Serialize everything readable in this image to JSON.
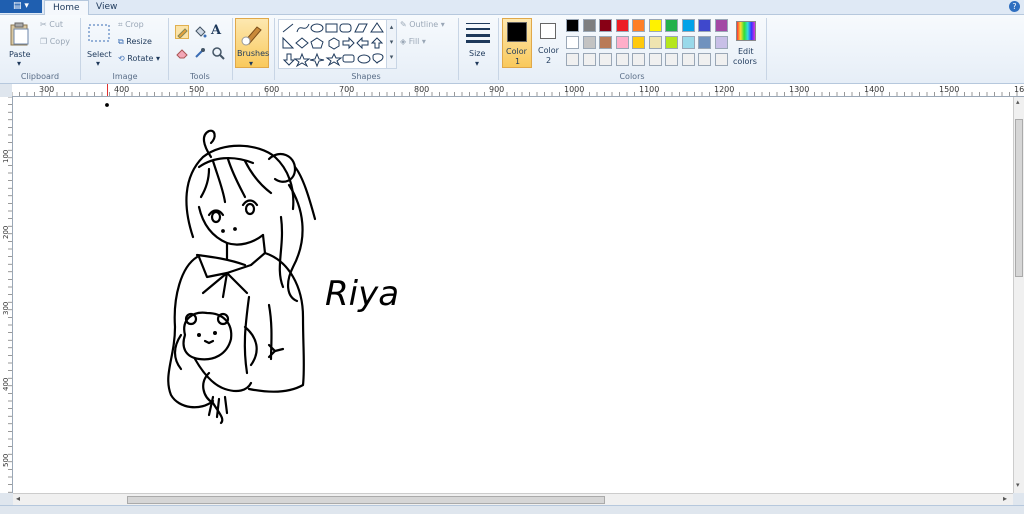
{
  "tabs": {
    "home": "Home",
    "view": "View"
  },
  "app_button": {
    "glyph": "▤ ▾"
  },
  "help": {
    "glyph": "?"
  },
  "clipboard": {
    "paste": "Paste",
    "cut": "Cut",
    "copy": "Copy",
    "label": "Clipboard"
  },
  "image": {
    "select": "Select",
    "crop": "Crop",
    "resize": "Resize",
    "rotate": "Rotate",
    "label": "Image"
  },
  "tools": {
    "label": "Tools"
  },
  "brushes": {
    "label": "Brushes"
  },
  "shapes": {
    "outline": "Outline",
    "fill": "Fill",
    "label": "Shapes"
  },
  "size": {
    "label": "Size"
  },
  "color_selectors": {
    "color1": "Color\n1",
    "color1_line1": "Color",
    "color1_line2": "1",
    "color2_line1": "Color",
    "color2_line2": "2",
    "color1_value": "#000000",
    "color2_value": "#ffffff"
  },
  "colors": {
    "label": "Colors",
    "row1": [
      "#000000",
      "#7f7f7f",
      "#880015",
      "#ed1c24",
      "#ff7f27",
      "#fff200",
      "#22b14c",
      "#00a2e8",
      "#3f48cc",
      "#a349a4"
    ],
    "row2": [
      "#ffffff",
      "#c3c3c3",
      "#b97a57",
      "#ffaec9",
      "#ffc90e",
      "#efe4b0",
      "#b5e61d",
      "#99d9ea",
      "#7092be",
      "#c8bfe7"
    ],
    "row3": [
      "#f0f0f0",
      "#f0f0f0",
      "#f0f0f0",
      "#f0f0f0",
      "#f0f0f0",
      "#f0f0f0",
      "#f0f0f0",
      "#f0f0f0",
      "#f0f0f0",
      "#f0f0f0"
    ]
  },
  "edit_colors": {
    "line1": "Edit",
    "line2": "colors"
  },
  "ruler": {
    "h_ticks": [
      "300",
      "400",
      "500",
      "600",
      "700",
      "800",
      "900",
      "1000",
      "1100",
      "1200",
      "1300",
      "1400",
      "1500",
      "16"
    ],
    "v_ticks": [
      "100",
      "200",
      "300",
      "400",
      "500"
    ]
  },
  "canvas": {
    "signature": "Riya"
  }
}
